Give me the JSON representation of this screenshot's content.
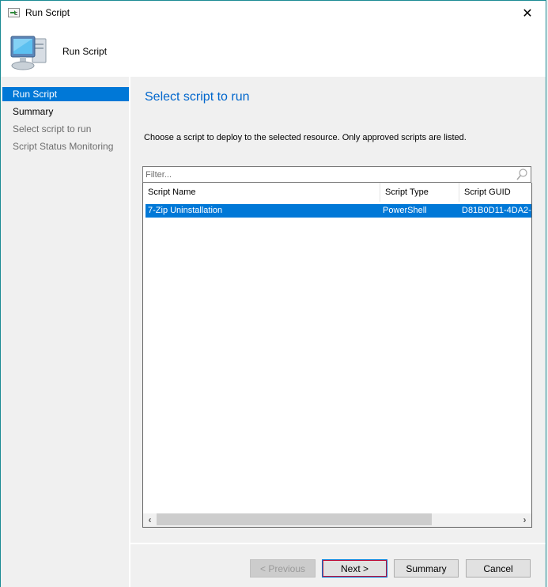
{
  "window": {
    "title": "Run Script",
    "app_icon": "run-script-window-icon",
    "close_icon": "close-icon"
  },
  "banner": {
    "title": "Run Script",
    "icon": "computer-icon"
  },
  "sidebar": {
    "items": [
      {
        "label": "Run Script",
        "state": "active"
      },
      {
        "label": "Summary",
        "state": "done"
      },
      {
        "label": "Select script to run",
        "state": "pending"
      },
      {
        "label": "Script Status Monitoring",
        "state": "pending"
      }
    ]
  },
  "main": {
    "heading": "Select script to run",
    "description": "Choose a script to deploy to the selected resource. Only approved scripts are listed.",
    "filter": {
      "value": "",
      "placeholder": "Filter...",
      "icon": "search-icon"
    },
    "table": {
      "columns": [
        "Script Name",
        "Script Type",
        "Script GUID"
      ],
      "rows": [
        {
          "name": "7-Zip Uninstallation",
          "type": "PowerShell",
          "guid": "D81B0D11-4DA2-",
          "selected": true
        }
      ]
    },
    "scrollbar": {
      "left_icon": "chevron-left-icon",
      "right_icon": "chevron-right-icon"
    }
  },
  "footer": {
    "previous_label": "< Previous",
    "next_label": "Next >",
    "summary_label": "Summary",
    "cancel_label": "Cancel"
  },
  "colors": {
    "accent": "#0078d7",
    "heading": "#0066cc",
    "window_border": "#1c8b94"
  }
}
